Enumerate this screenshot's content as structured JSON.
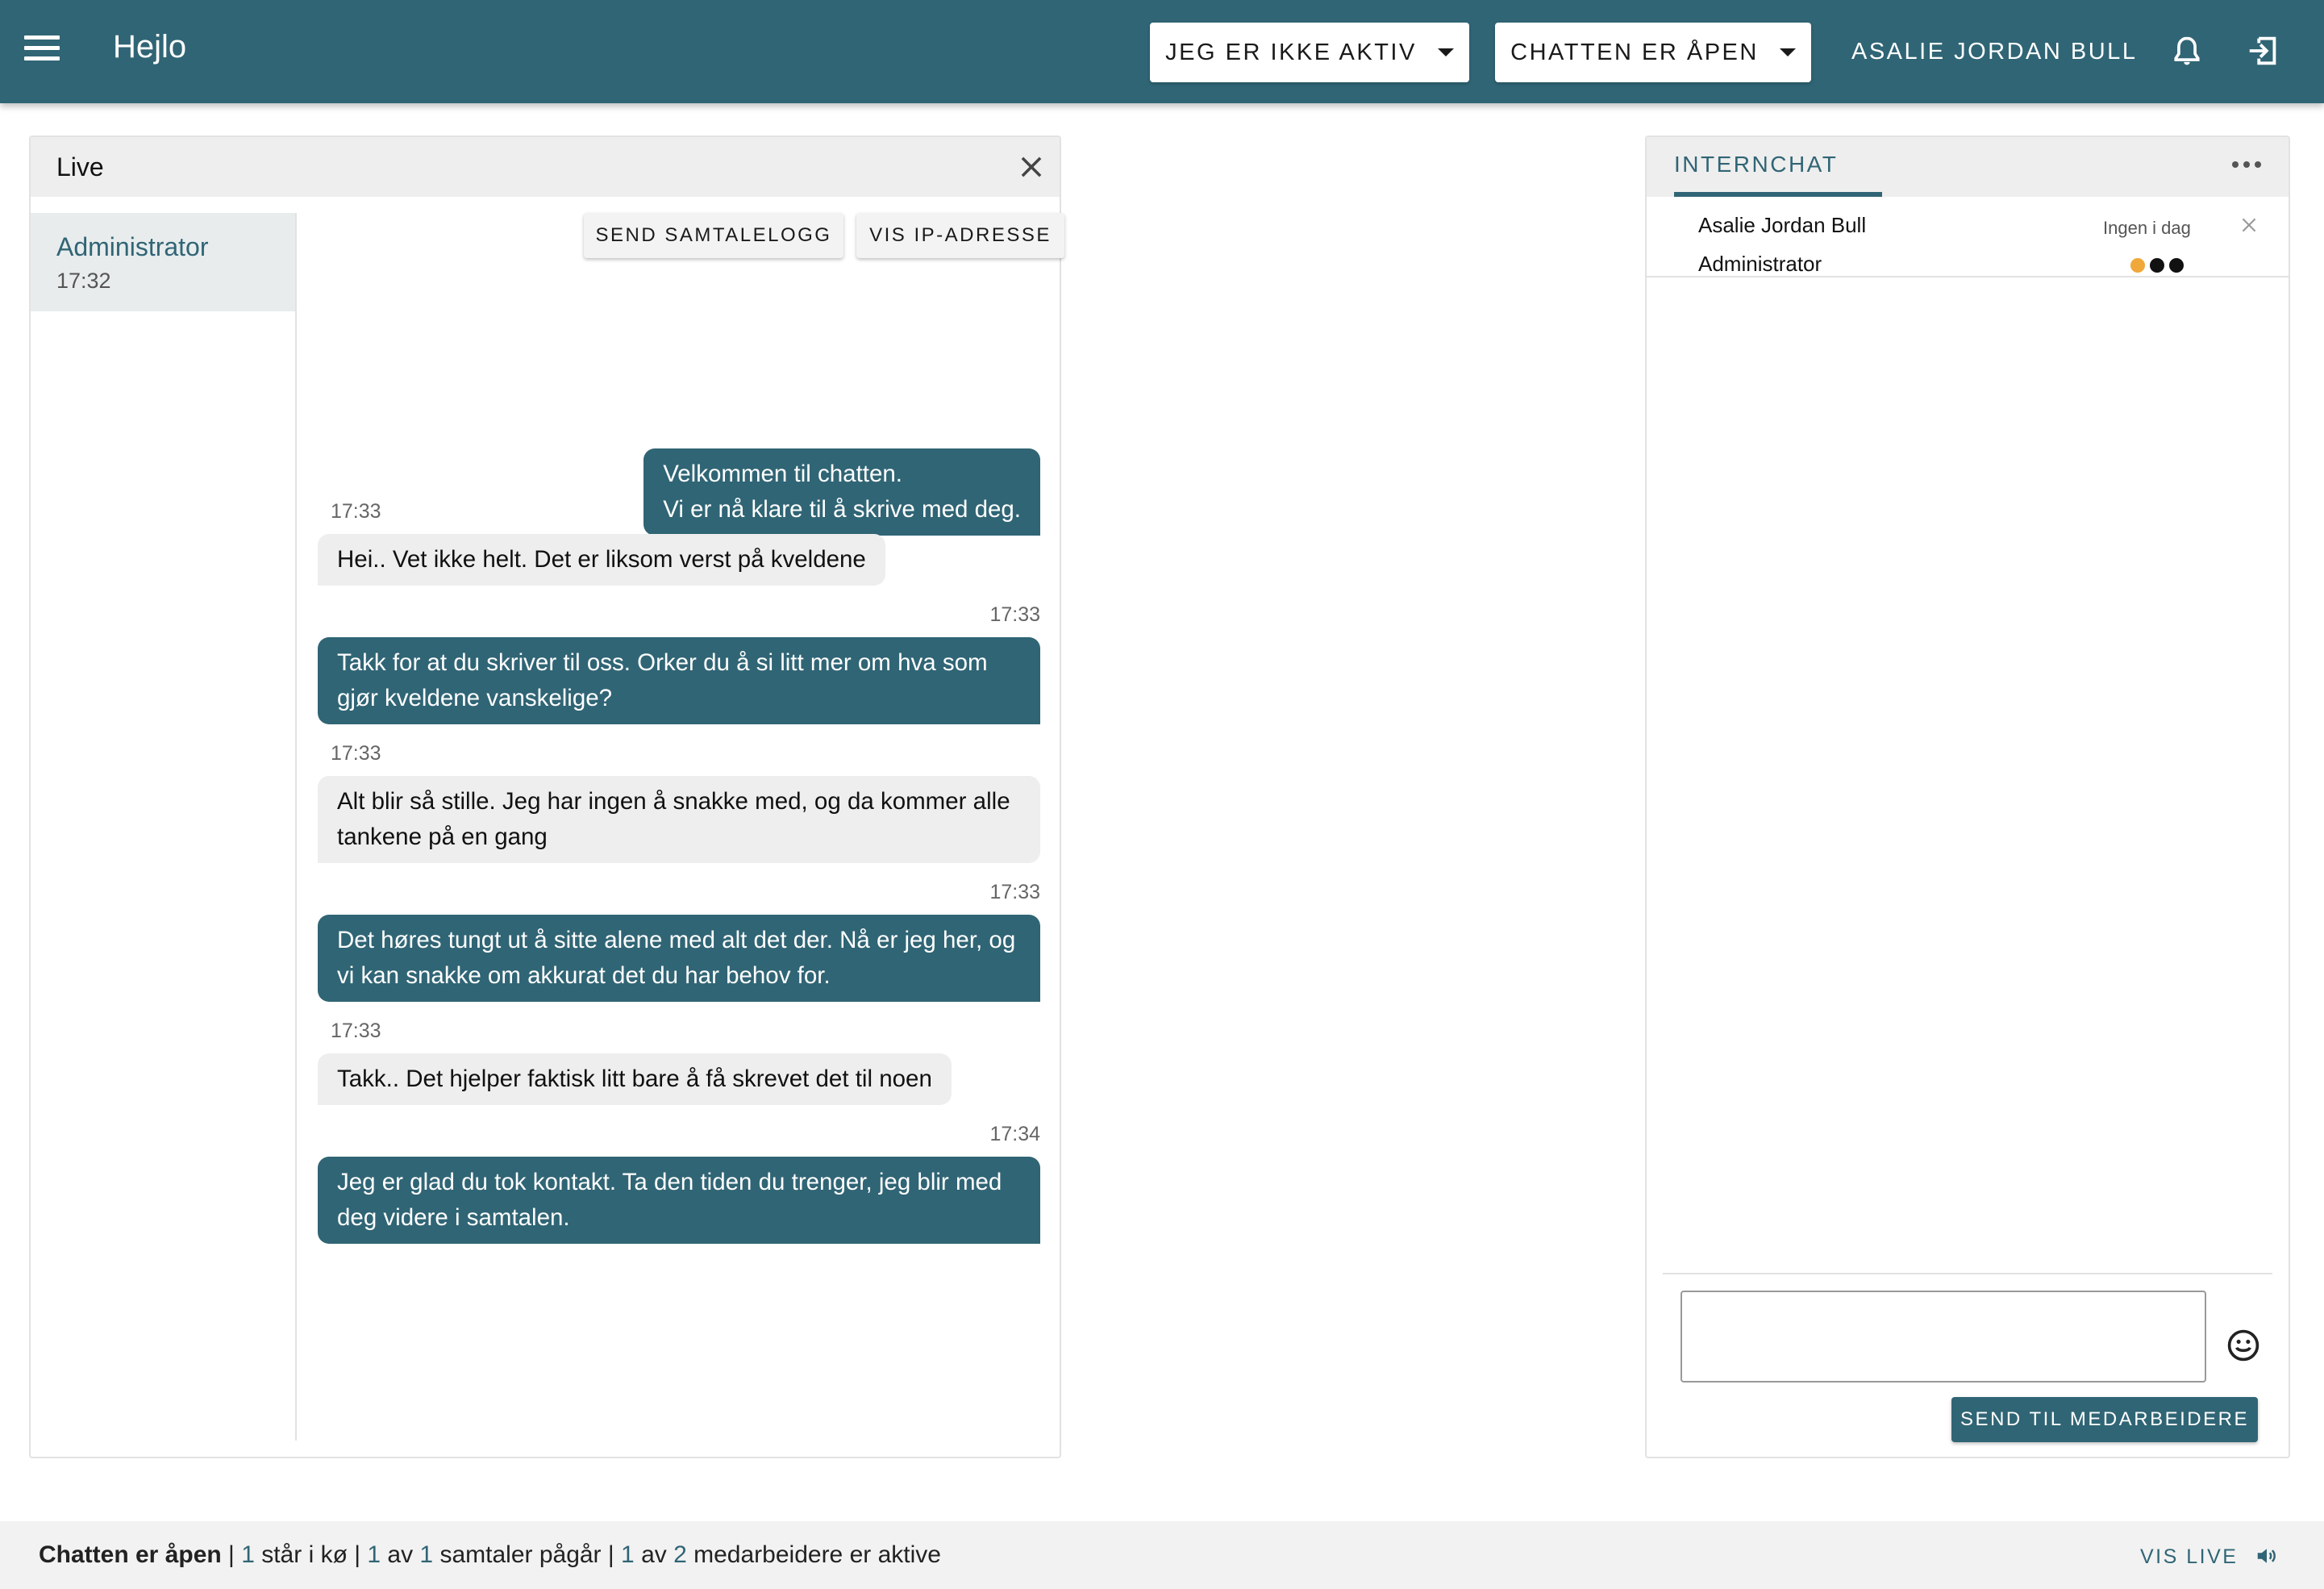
{
  "appbar": {
    "title": "Hejlo",
    "active_status": "JEG ER IKKE AKTIV",
    "chat_status": "CHATTEN ER ÅPEN",
    "user_name": "ASALIE JORDAN BULL"
  },
  "live": {
    "title": "Live",
    "conversations": [
      {
        "name": "Administrator",
        "time": "17:32"
      }
    ],
    "actions": {
      "send_log": "SEND SAMTALELOGG",
      "show_ip": "VIS IP-ADRESSE"
    },
    "messages": [
      {
        "direction": "out",
        "time": "",
        "lines": [
          "Velkommen til chatten.",
          "Vi er nå klare til å skrive med deg."
        ]
      },
      {
        "direction": "in",
        "time": "17:33",
        "text": "Hei.. Vet ikke helt. Det er liksom verst på kveldene"
      },
      {
        "direction": "out",
        "time": "17:33",
        "text": "Takk for at du skriver til oss. Orker du å si litt mer om hva som gjør kveldene vanskelige?"
      },
      {
        "direction": "in",
        "time": "17:33",
        "text": "Alt blir så stille. Jeg har ingen å snakke med, og da kommer alle tankene på en gang"
      },
      {
        "direction": "out",
        "time": "17:33",
        "text": "Det høres tungt ut å sitte alene med alt det der. Nå er jeg her, og vi kan snakke om akkurat det du har behov for."
      },
      {
        "direction": "in",
        "time": "17:33",
        "text": "Takk.. Det hjelper faktisk litt bare å få skrevet det til noen"
      },
      {
        "direction": "out",
        "time": "17:34",
        "text": "Jeg er glad du tok kontakt. Ta den tiden du trenger, jeg blir med deg videre i samtalen."
      }
    ]
  },
  "internchat": {
    "tab_label": "INTERNCHAT",
    "member": {
      "name": "Asalie Jordan Bull",
      "role": "Administrator",
      "status": "Ingen i dag",
      "dot_colors": [
        "#f0a83a",
        "#111111",
        "#111111"
      ]
    },
    "input_value": "",
    "send_label": "SEND TIL MEDARBEIDERE"
  },
  "footer": {
    "chat_state": "Chatten er åpen",
    "queue_count": "1",
    "queue_text": "står i kø",
    "conv_active": "1",
    "conv_of": "av",
    "conv_total": "1",
    "conv_text": "samtaler pågår",
    "staff_active": "1",
    "staff_of": "av",
    "staff_total": "2",
    "staff_text": "medarbeidere er aktive",
    "vis_live": "VIS LIVE"
  },
  "colors": {
    "primary": "#306575",
    "incoming_bubble": "#eeeeee",
    "panel_header": "#eeeeee"
  }
}
